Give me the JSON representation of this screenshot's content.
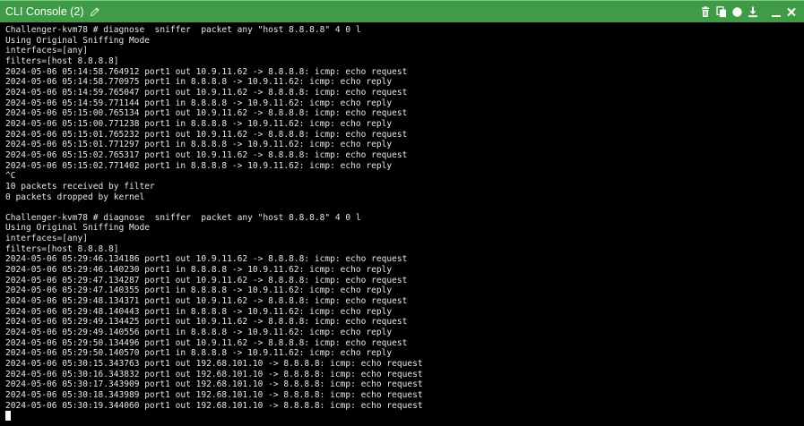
{
  "window": {
    "title": "CLI Console (2)",
    "colors": {
      "titlebar": "#3f9b46",
      "terminal_bg": "#000000",
      "terminal_fg": "#e6e6e6"
    },
    "icons": {
      "edit": "pencil-icon",
      "clear": "trash-icon",
      "copy": "copy-icon",
      "record": "record-icon",
      "download": "download-icon",
      "minimize": "minimize-icon",
      "close": "close-icon"
    }
  },
  "terminal": {
    "lines": [
      "Challenger-kvm78 # diagnose  sniffer  packet any \"host 8.8.8.8\" 4 0 l",
      "Using Original Sniffing Mode",
      "interfaces=[any]",
      "filters=[host 8.8.8.8]",
      "2024-05-06 05:14:58.764912 port1 out 10.9.11.62 -> 8.8.8.8: icmp: echo request",
      "2024-05-06 05:14:58.770975 port1 in 8.8.8.8 -> 10.9.11.62: icmp: echo reply",
      "2024-05-06 05:14:59.765047 port1 out 10.9.11.62 -> 8.8.8.8: icmp: echo request",
      "2024-05-06 05:14:59.771144 port1 in 8.8.8.8 -> 10.9.11.62: icmp: echo reply",
      "2024-05-06 05:15:00.765134 port1 out 10.9.11.62 -> 8.8.8.8: icmp: echo request",
      "2024-05-06 05:15:00.771238 port1 in 8.8.8.8 -> 10.9.11.62: icmp: echo reply",
      "2024-05-06 05:15:01.765232 port1 out 10.9.11.62 -> 8.8.8.8: icmp: echo request",
      "2024-05-06 05:15:01.771297 port1 in 8.8.8.8 -> 10.9.11.62: icmp: echo reply",
      "2024-05-06 05:15:02.765317 port1 out 10.9.11.62 -> 8.8.8.8: icmp: echo request",
      "2024-05-06 05:15:02.771402 port1 in 8.8.8.8 -> 10.9.11.62: icmp: echo reply",
      "^C",
      "10 packets received by filter",
      "0 packets dropped by kernel",
      "",
      "Challenger-kvm78 # diagnose  sniffer  packet any \"host 8.8.8.8\" 4 0 l",
      "Using Original Sniffing Mode",
      "interfaces=[any]",
      "filters=[host 8.8.8.8]",
      "2024-05-06 05:29:46.134186 port1 out 10.9.11.62 -> 8.8.8.8: icmp: echo request",
      "2024-05-06 05:29:46.140230 port1 in 8.8.8.8 -> 10.9.11.62: icmp: echo reply",
      "2024-05-06 05:29:47.134287 port1 out 10.9.11.62 -> 8.8.8.8: icmp: echo request",
      "2024-05-06 05:29:47.140355 port1 in 8.8.8.8 -> 10.9.11.62: icmp: echo reply",
      "2024-05-06 05:29:48.134371 port1 out 10.9.11.62 -> 8.8.8.8: icmp: echo request",
      "2024-05-06 05:29:48.140443 port1 in 8.8.8.8 -> 10.9.11.62: icmp: echo reply",
      "2024-05-06 05:29:49.134425 port1 out 10.9.11.62 -> 8.8.8.8: icmp: echo request",
      "2024-05-06 05:29:49.140556 port1 in 8.8.8.8 -> 10.9.11.62: icmp: echo reply",
      "2024-05-06 05:29:50.134496 port1 out 10.9.11.62 -> 8.8.8.8: icmp: echo request",
      "2024-05-06 05:29:50.140570 port1 in 8.8.8.8 -> 10.9.11.62: icmp: echo reply",
      "2024-05-06 05:30:15.343763 port1 out 192.68.101.10 -> 8.8.8.8: icmp: echo request",
      "2024-05-06 05:30:16.343832 port1 out 192.68.101.10 -> 8.8.8.8: icmp: echo request",
      "2024-05-06 05:30:17.343909 port1 out 192.68.101.10 -> 8.8.8.8: icmp: echo request",
      "2024-05-06 05:30:18.343989 port1 out 192.68.101.10 -> 8.8.8.8: icmp: echo request",
      "2024-05-06 05:30:19.344060 port1 out 192.68.101.10 -> 8.8.8.8: icmp: echo request"
    ]
  }
}
